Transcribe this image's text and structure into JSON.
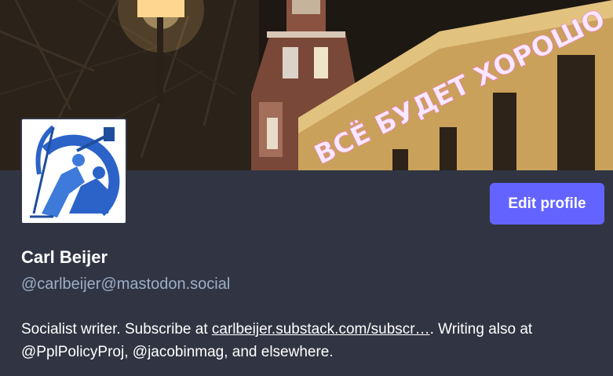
{
  "profile": {
    "display_name": "Carl Beijer",
    "handle": "@carlbeijer@mastodon.social",
    "edit_label": "Edit profile",
    "bio": {
      "part1": "Socialist writer. Subscribe at ",
      "link": "carlbeijer.substack.com/subscr…",
      "part2": ". Writing also at",
      "line2": "@PplPolicyProj, @jacobinmag, and elsewhere."
    }
  },
  "header": {
    "sign_text": "ВСЁ БУДЕТ ХОРОШО"
  },
  "colors": {
    "background": "#313543",
    "accent": "#6364ff",
    "handle": "#9baec8",
    "avatar_blue": "#2b63c9"
  }
}
